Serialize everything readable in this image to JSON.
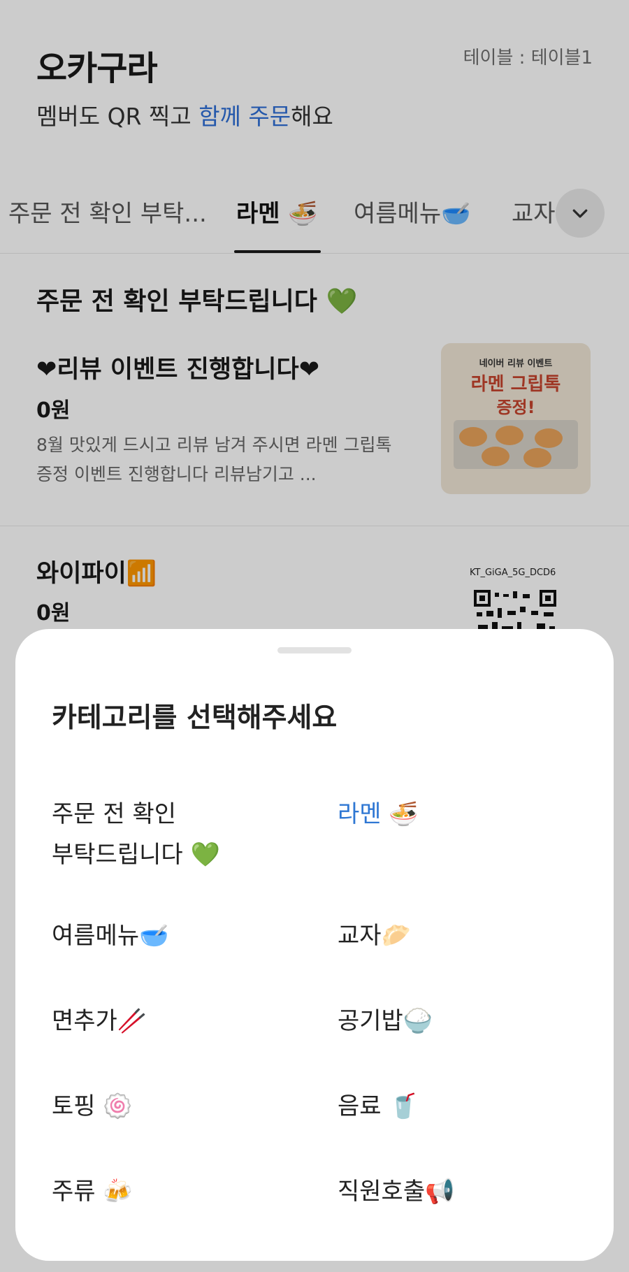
{
  "header": {
    "store_name": "오카구라",
    "table_label": "테이블 : 테이블1",
    "subtitle_before": "멤버도 QR 찍고 ",
    "subtitle_highlight": "함께 주문",
    "subtitle_after": "해요"
  },
  "tabs": [
    {
      "label": "주문 전 확인 부탁..."
    },
    {
      "label": "라멘 🍜",
      "active": true
    },
    {
      "label": "여름메뉴🥣"
    },
    {
      "label": "교자"
    }
  ],
  "tab_expand_icon": "chevron-down-icon",
  "menu": {
    "section_title": "주문 전 확인 부탁드립니다 💚",
    "items": [
      {
        "name": "❤리뷰 이벤트 진행합니다❤",
        "price": "0원",
        "desc_line1": "8월 맛있게 드시고 리뷰 남겨 주시면 라멘 그립톡",
        "desc_line2": "증정 이벤트 진행합니다  리뷰남기고 ..."
      },
      {
        "name": "와이파이📶",
        "price": "0원",
        "ssid": "KT_GiGA_5G_DCD6"
      }
    ],
    "promo": {
      "line1": "네이버 리뷰 이벤트",
      "line2": "라멘 그립톡",
      "line3": "증정!"
    }
  },
  "sheet": {
    "title": "카테고리를 선택해주세요",
    "categories": [
      {
        "line1": "주문 전 확인",
        "line2": "부탁드립니다 💚"
      },
      {
        "label": "라멘 🍜",
        "selected": true
      },
      {
        "label": "여름메뉴🥣"
      },
      {
        "label": "교자🥟"
      },
      {
        "label": "면추가🥢"
      },
      {
        "label": "공기밥🍚"
      },
      {
        "label": "토핑 🍥"
      },
      {
        "label": "음료 🥤"
      },
      {
        "label": "주류 🍻"
      },
      {
        "label": "직원호출📢"
      }
    ]
  },
  "colors": {
    "accent": "#2f77d3",
    "text": "#1a1a1a"
  }
}
